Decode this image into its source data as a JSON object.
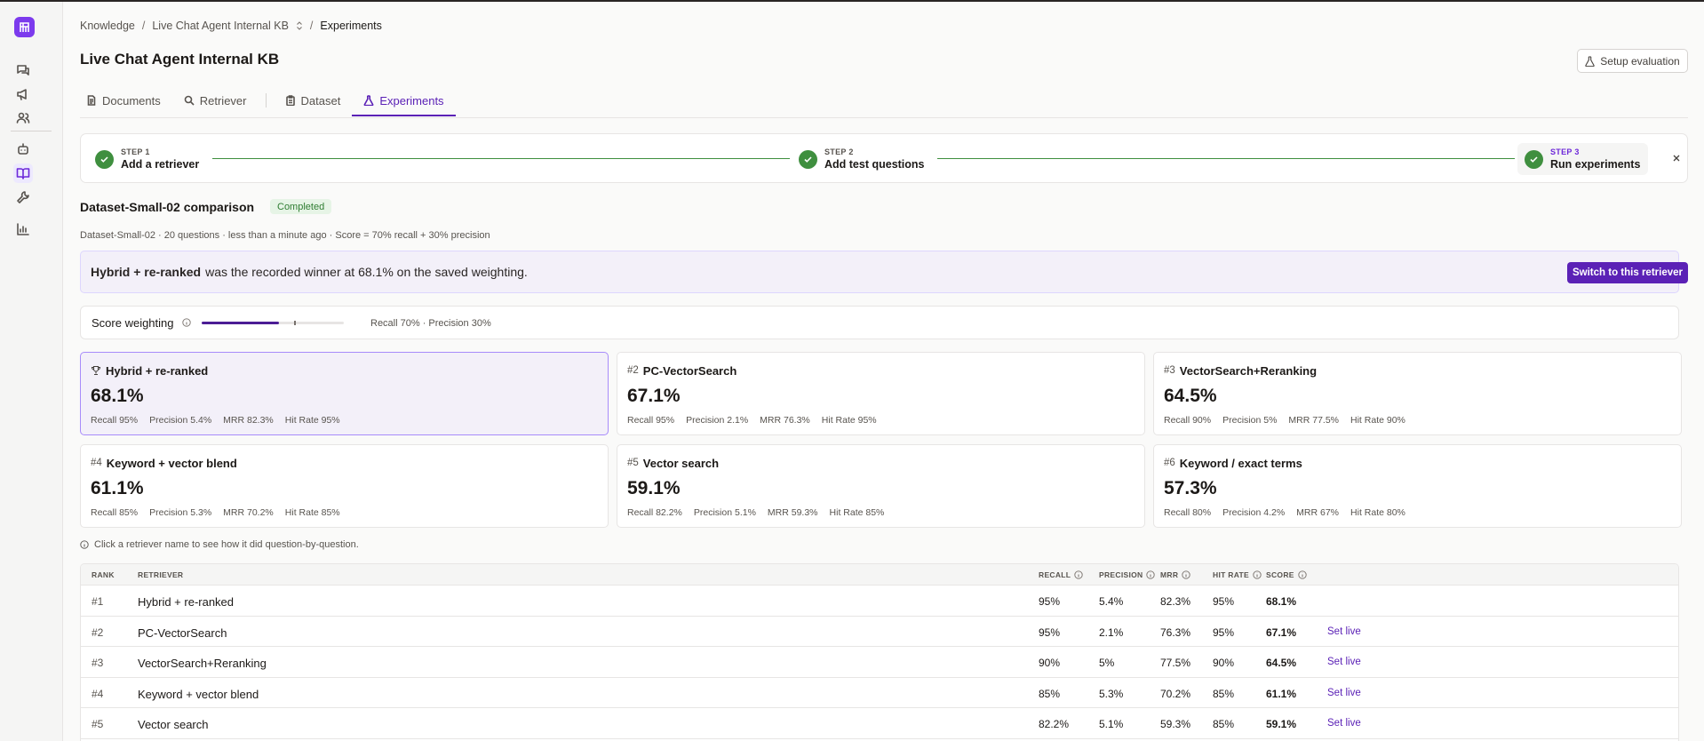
{
  "breadcrumb": {
    "items": [
      "Knowledge",
      "Live Chat Agent Internal KB",
      "Experiments"
    ],
    "separator": "/"
  },
  "page_title": "Live Chat Agent Internal KB",
  "setup_button": "Setup evaluation",
  "tabs": [
    {
      "label": "Documents",
      "icon": "document-icon"
    },
    {
      "label": "Retriever",
      "icon": "search-icon"
    },
    {
      "label": "Dataset",
      "icon": "clipboard-icon"
    },
    {
      "label": "Experiments",
      "icon": "flask-icon",
      "active": true
    }
  ],
  "stepper": {
    "steps": [
      {
        "kicker": "STEP 1",
        "name": "Add a retriever",
        "done": true
      },
      {
        "kicker": "STEP 2",
        "name": "Add test questions",
        "done": true
      },
      {
        "kicker": "STEP 3",
        "name": "Run experiments",
        "done": true,
        "current": true
      }
    ]
  },
  "run": {
    "title": "Dataset-Small-02 comparison",
    "status": "Completed",
    "meta": "Dataset-Small-02 · 20 questions · less than a minute ago · Score = 70% recall + 30% precision"
  },
  "winner_banner": {
    "name": "Hybrid + re-ranked",
    "text": "was the recorded winner at 68.1% on the saved weighting.",
    "button": "Switch to this retriever"
  },
  "weighting": {
    "label": "Score weighting",
    "recall_fraction": 0.7,
    "text": "Recall 70% · Precision 30%"
  },
  "cards": [
    {
      "rank": "",
      "name": "Hybrid + re-ranked",
      "score": "68.1%",
      "stats": [
        "Recall 95%",
        "Precision 5.4%",
        "MRR 82.3%",
        "Hit Rate 95%"
      ],
      "winner": true
    },
    {
      "rank": "#2",
      "name": "PC-VectorSearch",
      "score": "67.1%",
      "stats": [
        "Recall 95%",
        "Precision 2.1%",
        "MRR 76.3%",
        "Hit Rate 95%"
      ]
    },
    {
      "rank": "#3",
      "name": "VectorSearch+Reranking",
      "score": "64.5%",
      "stats": [
        "Recall 90%",
        "Precision 5%",
        "MRR 77.5%",
        "Hit Rate 90%"
      ]
    },
    {
      "rank": "#4",
      "name": "Keyword + vector blend",
      "score": "61.1%",
      "stats": [
        "Recall 85%",
        "Precision 5.3%",
        "MRR 70.2%",
        "Hit Rate 85%"
      ]
    },
    {
      "rank": "#5",
      "name": "Vector search",
      "score": "59.1%",
      "stats": [
        "Recall 82.2%",
        "Precision 5.1%",
        "MRR 59.3%",
        "Hit Rate 85%"
      ]
    },
    {
      "rank": "#6",
      "name": "Keyword / exact terms",
      "score": "57.3%",
      "stats": [
        "Recall 80%",
        "Precision 4.2%",
        "MRR 67%",
        "Hit Rate 80%"
      ]
    }
  ],
  "hint": "Click a retriever name to see how it did question-by-question.",
  "table": {
    "headers": [
      "RANK",
      "RETRIEVER",
      "RECALL",
      "PRECISION",
      "MRR",
      "HIT RATE",
      "SCORE"
    ],
    "rows": [
      {
        "rank": "#1",
        "name": "Hybrid + re-ranked",
        "recall": "95%",
        "precision": "5.4%",
        "mrr": "82.3%",
        "hit": "95%",
        "score": "68.1%",
        "action": ""
      },
      {
        "rank": "#2",
        "name": "PC-VectorSearch",
        "recall": "95%",
        "precision": "2.1%",
        "mrr": "76.3%",
        "hit": "95%",
        "score": "67.1%",
        "action": "Set live"
      },
      {
        "rank": "#3",
        "name": "VectorSearch+Reranking",
        "recall": "90%",
        "precision": "5%",
        "mrr": "77.5%",
        "hit": "90%",
        "score": "64.5%",
        "action": "Set live"
      },
      {
        "rank": "#4",
        "name": "Keyword + vector blend",
        "recall": "85%",
        "precision": "5.3%",
        "mrr": "70.2%",
        "hit": "85%",
        "score": "61.1%",
        "action": "Set live"
      },
      {
        "rank": "#5",
        "name": "Vector search",
        "recall": "82.2%",
        "precision": "5.1%",
        "mrr": "59.3%",
        "hit": "85%",
        "score": "59.1%",
        "action": "Set live"
      }
    ]
  },
  "colors": {
    "accent": "#5b21b6",
    "success": "#3f8f3f",
    "brand": "#7c3aed"
  },
  "sidebar_icons": [
    "chat-icon",
    "megaphone-icon",
    "users-icon",
    "bot-icon",
    "book-icon",
    "wrench-icon",
    "chart-icon"
  ]
}
